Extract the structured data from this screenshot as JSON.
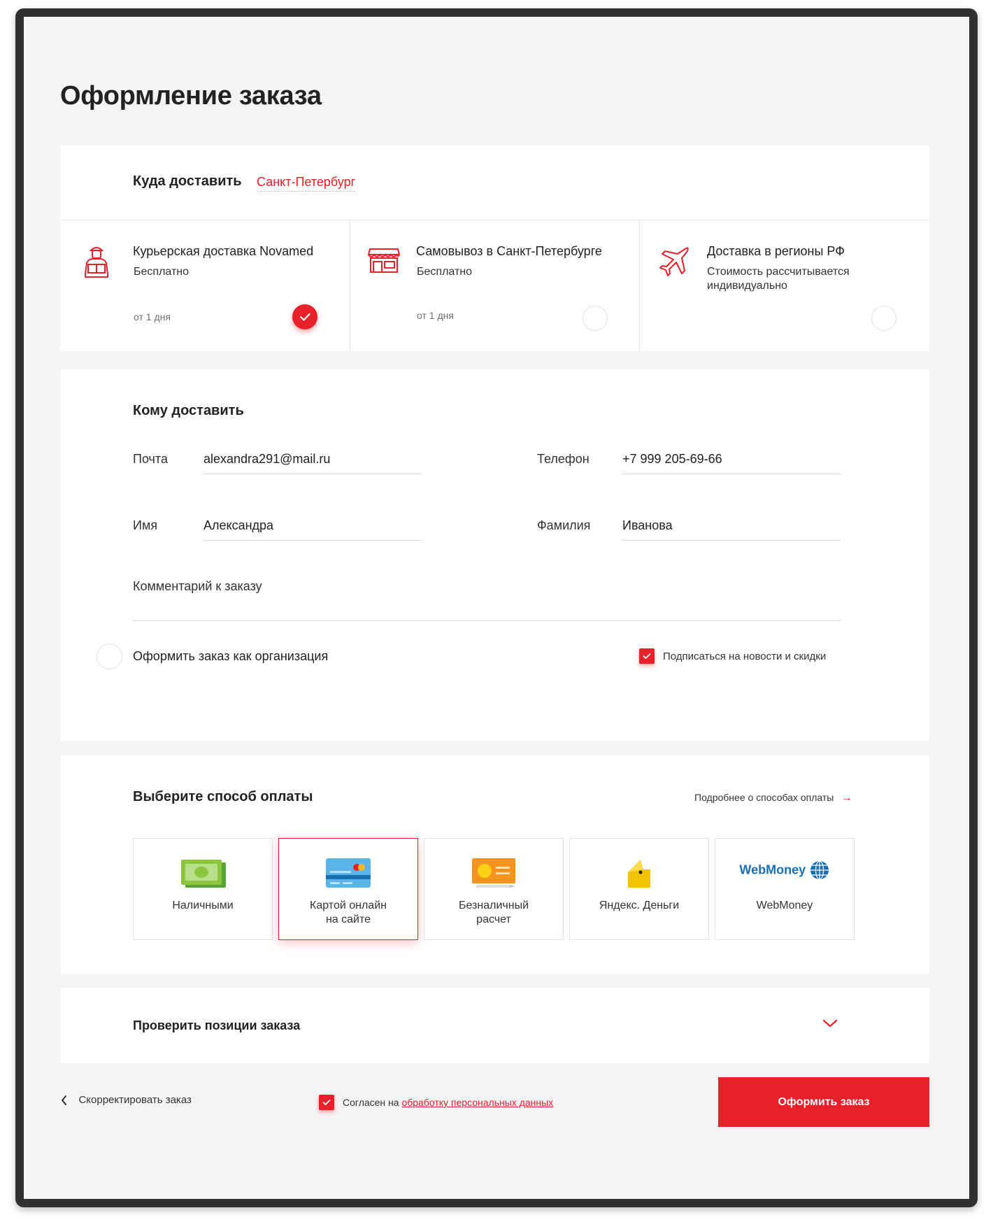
{
  "page": {
    "title": "Оформление заказа"
  },
  "delivery": {
    "heading": "Куда доставить",
    "city": "Санкт-Петербург",
    "options": [
      {
        "name": "Курьерская доставка Novamed",
        "price": "Бесплатно",
        "time": "от 1 дня",
        "selected": true,
        "icon": "courier-icon"
      },
      {
        "name": "Самовывоз в Санкт-Петербурге",
        "price": "Бесплатно",
        "time": "от 1 дня",
        "selected": false,
        "icon": "store-icon"
      },
      {
        "name": "Доставка в регионы РФ",
        "price": "Стоимость рассчитывается индивидуально",
        "time": "",
        "selected": false,
        "icon": "airplane-icon"
      }
    ]
  },
  "recipient": {
    "heading": "Кому доставить",
    "email_label": "Почта",
    "email_value": "alexandra291@mail.ru",
    "phone_label": "Телефон",
    "phone_value": "+7 999 205-69-66",
    "name_label": "Имя",
    "name_value": "Александра",
    "surname_label": "Фамилия",
    "surname_value": "Иванова",
    "comment_label": "Комментарий к заказу",
    "comment_value": "",
    "org_label": "Оформить заказ как организация",
    "org_checked": false,
    "subscribe_label": "Подписаться на новости и скидки",
    "subscribe_checked": true
  },
  "payment": {
    "heading": "Выберите способ оплаты",
    "more_link": "Подробнее о способах оплаты",
    "methods": [
      {
        "label": "Наличными",
        "icon": "cash-icon",
        "selected": false
      },
      {
        "label": "Картой онлайн на сайте",
        "icon": "credit-card-icon",
        "selected": true
      },
      {
        "label": "Безналичный расчет",
        "icon": "invoice-icon",
        "selected": false
      },
      {
        "label": "Яндекс. Деньги",
        "icon": "yandex-money-icon",
        "selected": false
      },
      {
        "label": "WebMoney",
        "icon": "webmoney-logo",
        "logo_text": "WebMoney",
        "selected": false
      }
    ]
  },
  "review": {
    "label": "Проверить позиции заказа"
  },
  "footer": {
    "back_label": "Скорректировать заказ",
    "agree_prefix": "Согласен на ",
    "agree_link": "обработку персональных данных",
    "agree_checked": true,
    "submit_label": "Оформить заказ"
  },
  "colors": {
    "accent": "#e8202a",
    "background": "#f4f4f4",
    "card": "#ffffff"
  }
}
